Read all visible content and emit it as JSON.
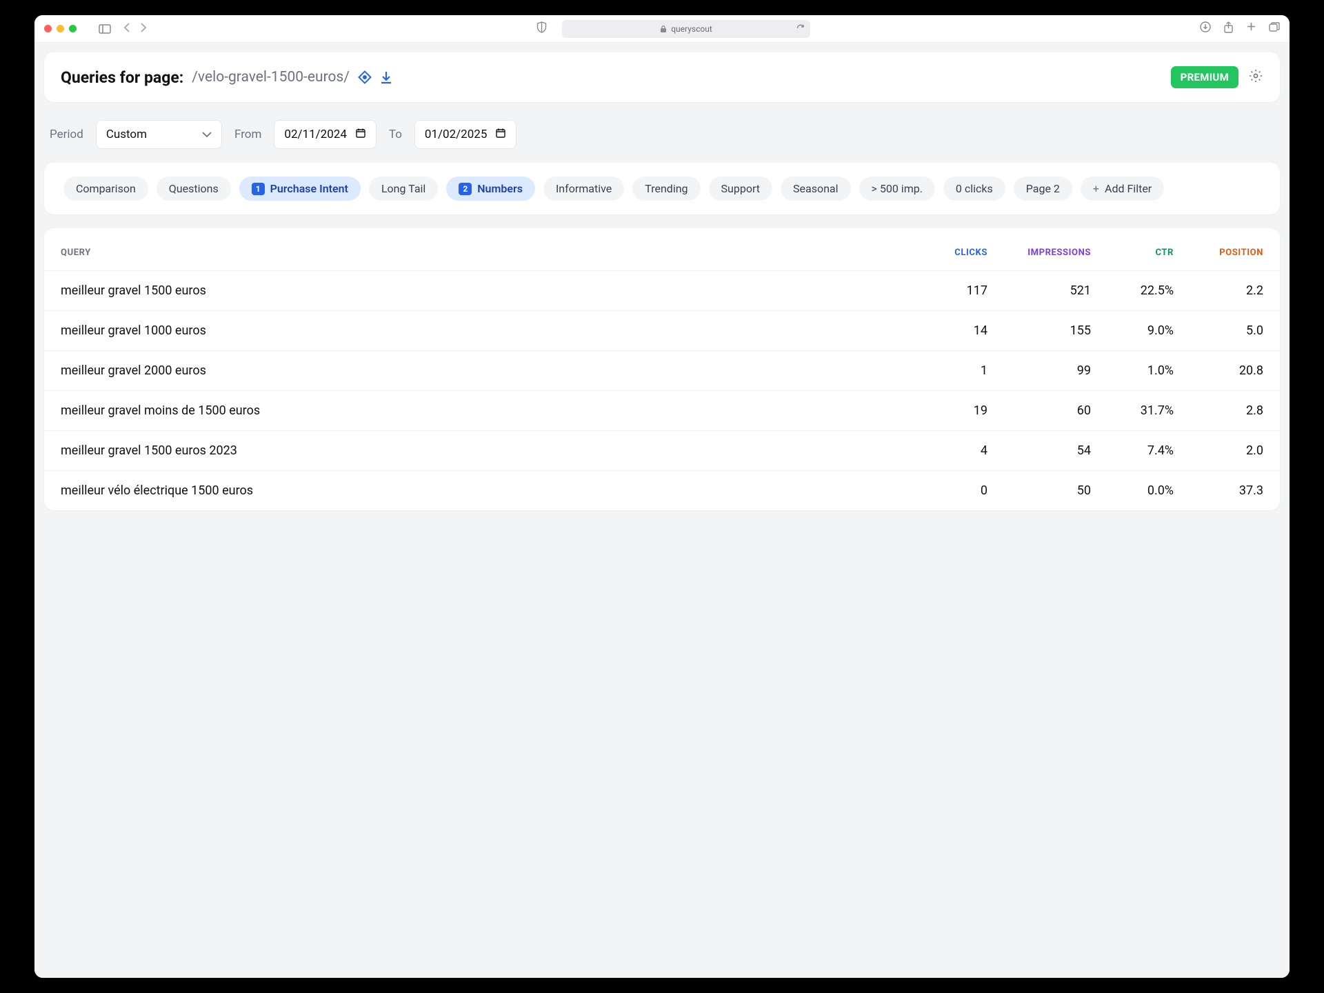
{
  "browser": {
    "url_host": "queryscout"
  },
  "header": {
    "title": "Queries for page:",
    "path": "/velo-gravel-1500-euros/",
    "premium": "PREMIUM"
  },
  "period": {
    "label": "Period",
    "preset": "Custom",
    "from_label": "From",
    "from_value": "02/11/2024",
    "to_label": "To",
    "to_value": "01/02/2025"
  },
  "filters": [
    {
      "label": "Comparison",
      "active": false,
      "badge": null
    },
    {
      "label": "Questions",
      "active": false,
      "badge": null
    },
    {
      "label": "Purchase Intent",
      "active": true,
      "badge": "1"
    },
    {
      "label": "Long Tail",
      "active": false,
      "badge": null
    },
    {
      "label": "Numbers",
      "active": true,
      "badge": "2"
    },
    {
      "label": "Informative",
      "active": false,
      "badge": null
    },
    {
      "label": "Trending",
      "active": false,
      "badge": null
    },
    {
      "label": "Support",
      "active": false,
      "badge": null
    },
    {
      "label": "Seasonal",
      "active": false,
      "badge": null
    },
    {
      "label": "> 500 imp.",
      "active": false,
      "badge": null
    },
    {
      "label": "0 clicks",
      "active": false,
      "badge": null
    },
    {
      "label": "Page 2",
      "active": false,
      "badge": null
    }
  ],
  "add_filter": "Add Filter",
  "columns": {
    "query": "QUERY",
    "clicks": "CLICKS",
    "impressions": "IMPRESSIONS",
    "ctr": "CTR",
    "position": "POSITION"
  },
  "rows": [
    {
      "query": "meilleur gravel 1500 euros",
      "clicks": "117",
      "impressions": "521",
      "ctr": "22.5%",
      "position": "2.2"
    },
    {
      "query": "meilleur gravel 1000 euros",
      "clicks": "14",
      "impressions": "155",
      "ctr": "9.0%",
      "position": "5.0"
    },
    {
      "query": "meilleur gravel 2000 euros",
      "clicks": "1",
      "impressions": "99",
      "ctr": "1.0%",
      "position": "20.8"
    },
    {
      "query": "meilleur gravel moins de 1500 euros",
      "clicks": "19",
      "impressions": "60",
      "ctr": "31.7%",
      "position": "2.8"
    },
    {
      "query": "meilleur gravel 1500 euros 2023",
      "clicks": "4",
      "impressions": "54",
      "ctr": "7.4%",
      "position": "2.0"
    },
    {
      "query": "meilleur vélo électrique 1500 euros",
      "clicks": "0",
      "impressions": "50",
      "ctr": "0.0%",
      "position": "37.3"
    }
  ]
}
